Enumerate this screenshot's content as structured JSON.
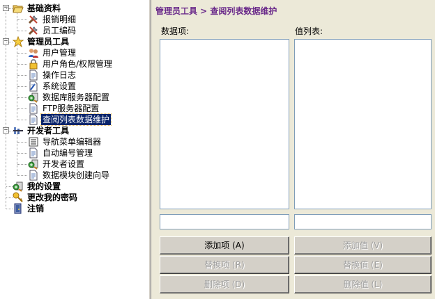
{
  "tree": {
    "items": [
      {
        "label": "基础资料",
        "bold": true,
        "level": 0,
        "icon": "folder-open-icon"
      },
      {
        "label": "报销明细",
        "level": 1,
        "icon": "tools-icon"
      },
      {
        "label": "员工编码",
        "level": 1,
        "icon": "tools-icon"
      },
      {
        "label": "管理员工具",
        "bold": true,
        "level": 0,
        "icon": "star-icon"
      },
      {
        "label": "用户管理",
        "level": 1,
        "icon": "users-icon"
      },
      {
        "label": "用户角色/权限管理",
        "level": 1,
        "icon": "lock-icon"
      },
      {
        "label": "操作日志",
        "level": 1,
        "icon": "document-icon"
      },
      {
        "label": "系统设置",
        "level": 1,
        "icon": "settings-doc-icon"
      },
      {
        "label": "数据库服务器配置",
        "level": 1,
        "icon": "db-server-icon"
      },
      {
        "label": "FTP服务器配置",
        "level": 1,
        "icon": "document-icon"
      },
      {
        "label": "查阅列表数据维护",
        "level": 1,
        "icon": "document-icon",
        "selected": true
      },
      {
        "label": "开发者工具",
        "bold": true,
        "level": 0,
        "icon": "dev-tools-icon"
      },
      {
        "label": "导航菜单编辑器",
        "level": 1,
        "icon": "list-icon"
      },
      {
        "label": "自动编号管理",
        "level": 1,
        "icon": "document-icon"
      },
      {
        "label": "开发者设置",
        "level": 1,
        "icon": "db-server-icon"
      },
      {
        "label": "数据模块创建向导",
        "level": 1,
        "icon": "document-icon"
      },
      {
        "label": "我的设置",
        "bold": true,
        "level": 0,
        "icon": "db-server-icon"
      },
      {
        "label": "更改我的密码",
        "bold": true,
        "level": 0,
        "icon": "key-icon"
      },
      {
        "label": "注销",
        "bold": true,
        "level": 0,
        "icon": "logout-door-icon"
      }
    ]
  },
  "panel": {
    "breadcrumb": "管理员工具 > 查阅列表数据维护",
    "data_items_label": "数据项:",
    "value_list_label": "值列表:",
    "buttons": {
      "add_item": "添加项 (A)",
      "replace_item": "替换项 (R)",
      "delete_item": "删除项 (D)",
      "add_value": "添加值 (V)",
      "replace_value": "替换值 (E)",
      "delete_value": "删除值 (L)"
    }
  },
  "colors": {
    "breadcrumb": "#6a2a8a",
    "selection": "#0a246a",
    "panel_bg": "#ece9d8",
    "button_face": "#d4d0c8"
  }
}
